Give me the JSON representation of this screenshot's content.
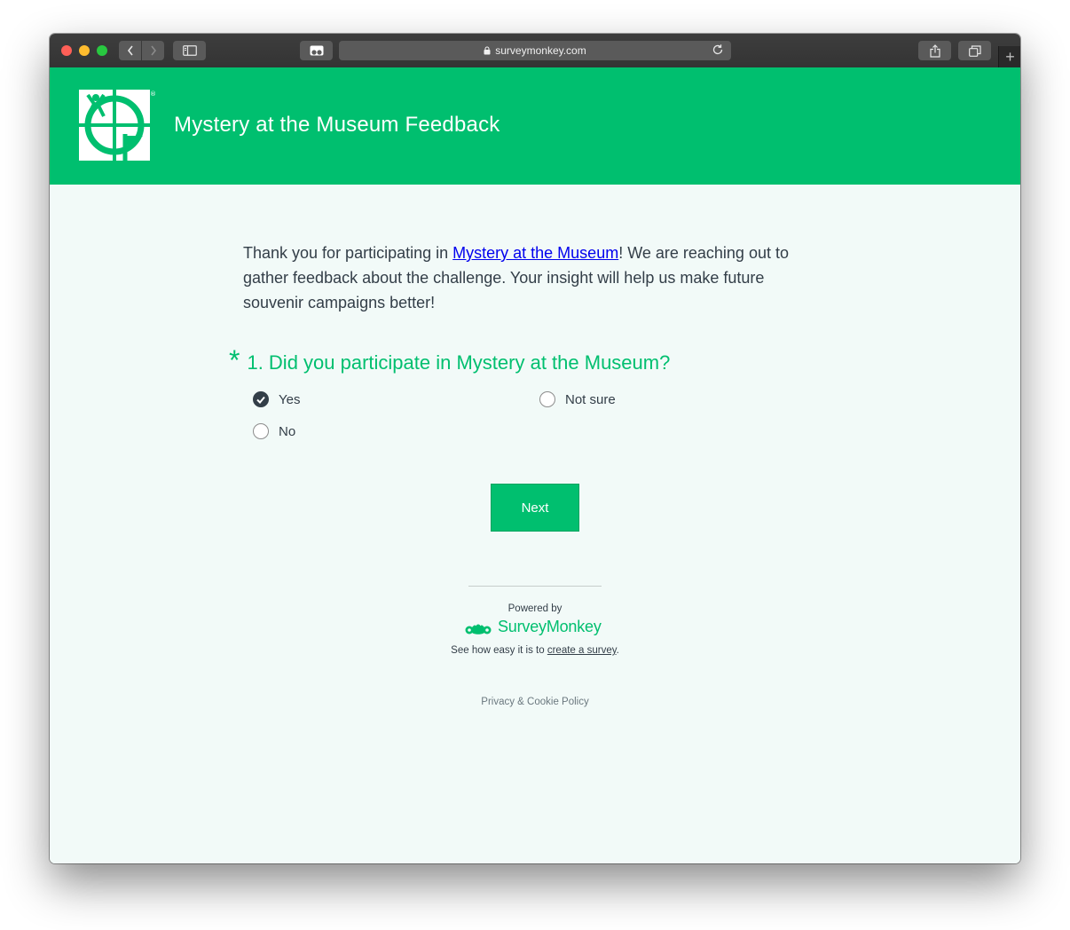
{
  "browser": {
    "url": "surveymonkey.com",
    "new_tab_label": "+"
  },
  "survey": {
    "title": "Mystery at the Museum Feedback",
    "brand_color": "#00bf6f",
    "intro": {
      "before_link": "Thank you for participating in ",
      "link_text": "Mystery at the Museum",
      "after_link": "! We are reaching out to gather feedback about the challenge. Your insight will help us make future souvenir campaigns better!"
    },
    "question": {
      "required_mark": "*",
      "text": "1. Did you participate in Mystery at the Museum?",
      "options": [
        {
          "label": "Yes",
          "selected": true
        },
        {
          "label": "No",
          "selected": false
        },
        {
          "label": "Not sure",
          "selected": false
        }
      ]
    },
    "next_label": "Next"
  },
  "footer": {
    "powered_by": "Powered by",
    "brand_name": "SurveyMonkey",
    "create_prefix": "See how easy it is to ",
    "create_link": "create a survey",
    "create_suffix": ".",
    "privacy": "Privacy & Cookie Policy"
  },
  "icons": {
    "back": "chevron-left-icon",
    "forward": "chevron-right-icon",
    "sidebar": "sidebar-icon",
    "reader": "reader-icon",
    "lock": "lock-icon",
    "reload": "reload-icon",
    "share": "share-icon",
    "tabs": "tabs-icon",
    "check": "checkmark-icon"
  }
}
